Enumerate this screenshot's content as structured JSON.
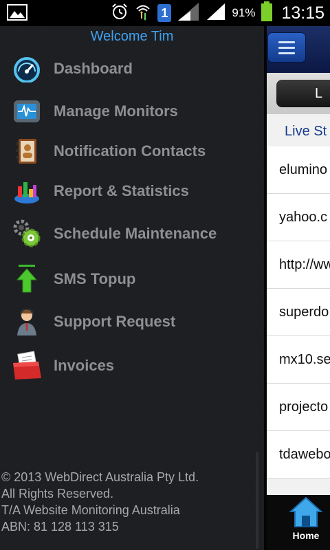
{
  "status_bar": {
    "battery_percent": "91%",
    "time": "13:15",
    "sim_slot": "1",
    "icons": [
      "image-icon",
      "alarm-icon",
      "data-transfer-icon",
      "sim-icon",
      "signal-icon",
      "signal-icon",
      "battery-icon"
    ]
  },
  "drawer": {
    "welcome": "Welcome Tim",
    "items": [
      {
        "label": "Dashboard",
        "icon": "speedometer-icon"
      },
      {
        "label": "Manage Monitors",
        "icon": "monitor-icon"
      },
      {
        "label": "Notification Contacts",
        "icon": "address-book-icon"
      },
      {
        "label": "Report & Statistics",
        "icon": "bar-chart-icon"
      },
      {
        "label": "Schedule Maintenance",
        "icon": "gears-icon"
      },
      {
        "label": "SMS Topup",
        "icon": "upload-arrow-icon"
      },
      {
        "label": "Support Request",
        "icon": "support-person-icon"
      },
      {
        "label": "Invoices",
        "icon": "invoice-folder-icon"
      }
    ],
    "footer": [
      "© 2013 WebDirect Australia Pty Ltd.",
      "All Rights Reserved.",
      "T/A Website Monitoring Australia",
      "ABN: 81 128 113 315"
    ]
  },
  "main": {
    "tab_label": "L",
    "section_title": "Live St",
    "rows": [
      "elumino",
      "yahoo.c",
      "http://ww",
      "superdo",
      "mx10.se",
      "projecto",
      "tdawebo"
    ],
    "bottom_nav": {
      "home_label": "Home"
    }
  },
  "colors": {
    "accent": "#3ea2f2",
    "drawer_text": "#8e8f92",
    "topbar": "#1c2f66",
    "section_title": "#163a8c"
  }
}
